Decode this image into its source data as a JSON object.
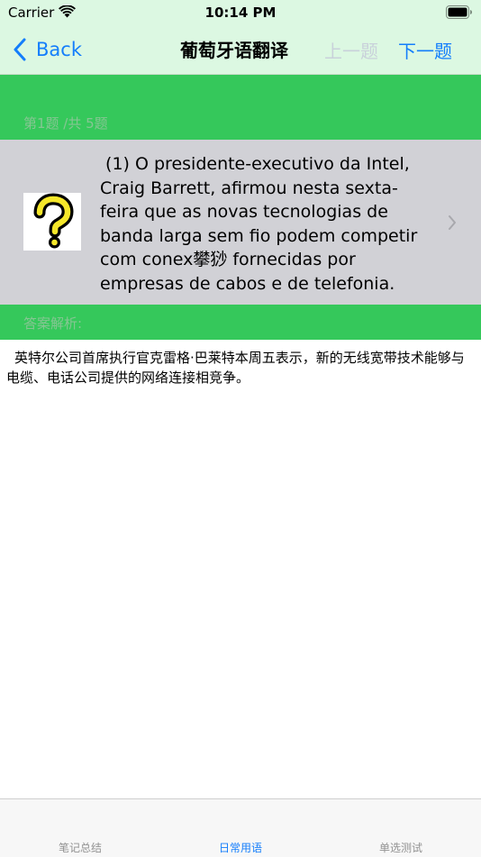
{
  "status_bar": {
    "carrier": "Carrier",
    "time": "10:14 PM"
  },
  "nav": {
    "back_label": "Back",
    "title": "葡萄牙语翻译",
    "prev_label": "上一题",
    "next_label": "下一题"
  },
  "counter": "第1题 /共 5题",
  "question": {
    "text": " (1) O presidente-executivo da Intel, Craig Barrett, afirmou nesta sexta-feira que as novas tecnologias de banda larga sem fio podem competir com conex攀猀 fornecidas por empresas de cabos e de telefonia.",
    "icon": "question-mark-icon"
  },
  "answer": {
    "label": "答案解析:",
    "text": "英特尔公司首席执行官克雷格·巴莱特本周五表示，新的无线宽带技术能够与电缆、电话公司提供的网络连接相竞争。"
  },
  "tabs": [
    {
      "label": "笔记总结",
      "active": false
    },
    {
      "label": "日常用语",
      "active": true
    },
    {
      "label": "单选测试",
      "active": false
    }
  ],
  "colors": {
    "nav_background": "#dcf8e2",
    "green": "#35c85b",
    "accent": "#147efb",
    "question_background": "#d1d1d6",
    "disabled": "#c9d1da"
  }
}
